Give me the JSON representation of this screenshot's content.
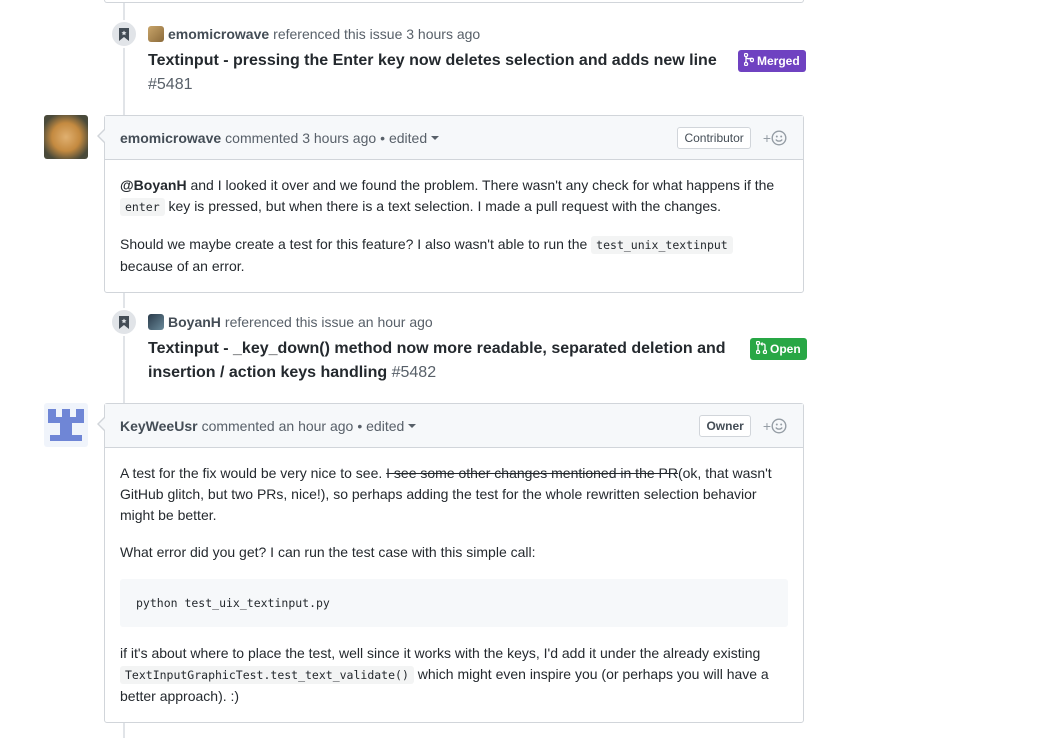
{
  "timeline": {
    "ref1": {
      "user": "emomicrowave",
      "action": "referenced this issue",
      "time": "3 hours ago",
      "title": "Textinput - pressing the Enter key now deletes selection and adds new line",
      "number": "#5481",
      "state": "Merged"
    },
    "comment1": {
      "author": "emomicrowave",
      "action": "commented",
      "time": "3 hours ago",
      "edited": "• edited",
      "role": "Contributor",
      "p1_mention": "@BoyanH",
      "p1_a": " and I looked it over and we found the problem. There wasn't any check for what happens if the ",
      "p1_code": "enter",
      "p1_b": " key is pressed, but when there is a text selection. I made a pull request with the changes.",
      "p2_a": "Should we maybe create a test for this feature? I also wasn't able to run the ",
      "p2_code": "test_unix_textinput",
      "p2_b": " because of an error."
    },
    "ref2": {
      "user": "BoyanH",
      "action": "referenced this issue",
      "time": "an hour ago",
      "title": "Textinput - _key_down() method now more readable, separated deletion and insertion / action keys handling",
      "number": "#5482",
      "state": "Open"
    },
    "comment2": {
      "author": "KeyWeeUsr",
      "action": "commented",
      "time": "an hour ago",
      "edited": "• edited",
      "role": "Owner",
      "p1_a": "A test for the fix would be very nice to see. ",
      "p1_strike": "I see some other changes mentioned in the PR",
      "p1_b": "(ok, that wasn't GitHub glitch, but two PRs, nice!), so perhaps adding the test for the whole rewritten selection behavior might be better.",
      "p2": "What error did you get? I can run the test case with this simple call:",
      "pre": "python test_uix_textinput.py",
      "p3_a": "if it's about where to place the test, well since it works with the keys, I'd add it under the already existing ",
      "p3_code": "TextInputGraphicTest.test_text_validate()",
      "p3_b": " which might even inspire you (or perhaps you will have a better approach). :)"
    }
  },
  "icons": {
    "bookmark": "bookmark-icon",
    "merge": "git-merge-icon",
    "pr": "git-pull-request-icon",
    "reaction": "smiley-icon",
    "reaction_plus": "+"
  },
  "colors": {
    "merged": "#6f42c1",
    "open": "#28a745",
    "border": "#d1d5da",
    "header_bg": "#f6f8fa"
  }
}
